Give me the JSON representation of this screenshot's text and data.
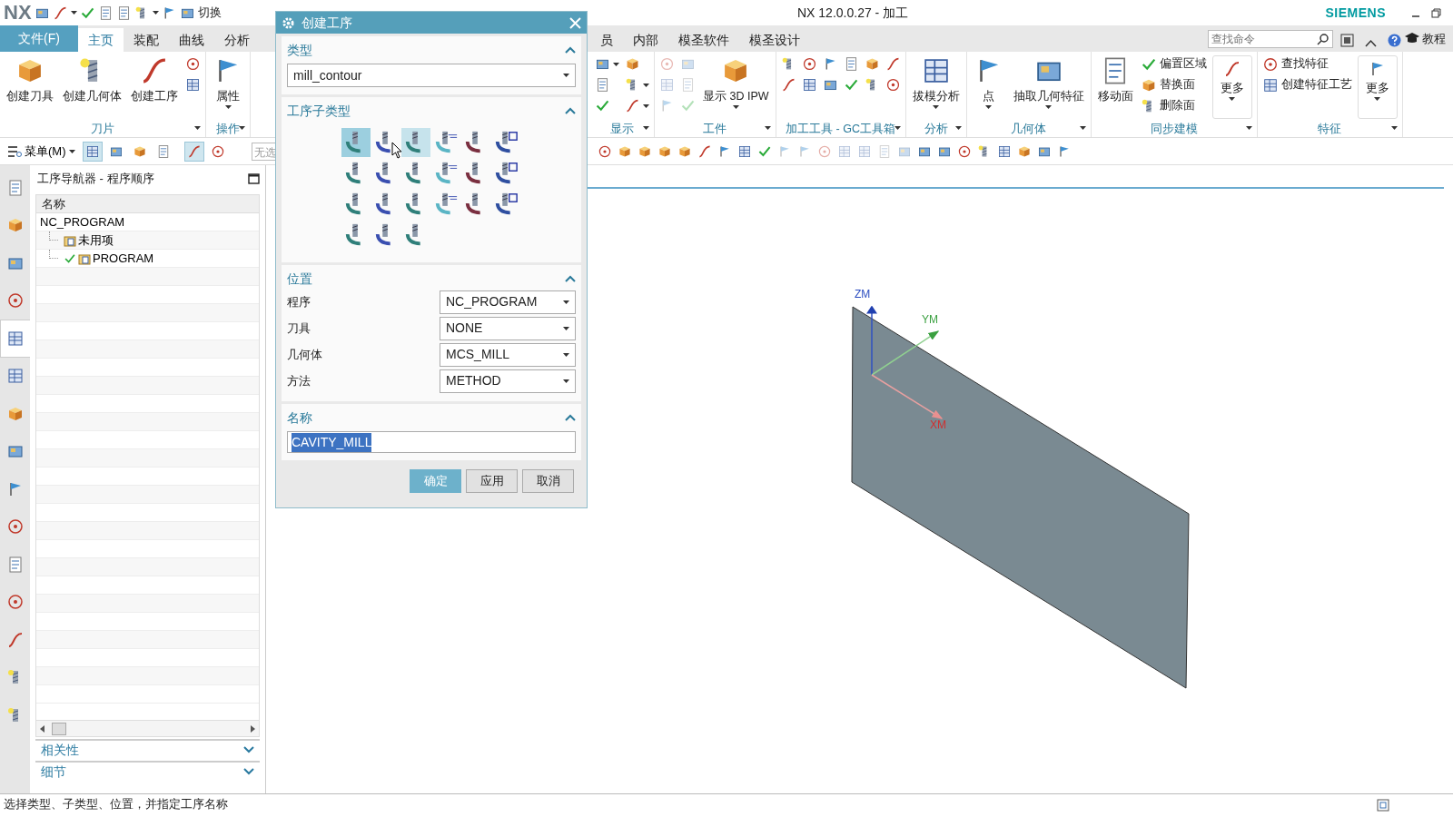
{
  "title_bar": {
    "logo": "NX",
    "switch_window_label": "切换",
    "title": "NX 12.0.0.27 - 加工",
    "brand": "SIEMENS"
  },
  "ribbon_tabs_left": [
    {
      "label": "文件(F)",
      "kind": "file",
      "selected": false
    },
    {
      "label": "主页",
      "kind": "tab",
      "selected": true
    },
    {
      "label": "装配",
      "kind": "tab",
      "selected": false
    },
    {
      "label": "曲线",
      "kind": "tab",
      "selected": false
    },
    {
      "label": "分析",
      "kind": "tab",
      "selected": false
    }
  ],
  "ribbon_tabs_right": [
    {
      "label": "员",
      "kind": "tab",
      "selected": false
    },
    {
      "label": "内部",
      "kind": "tab",
      "selected": false
    },
    {
      "label": "模圣软件",
      "kind": "tab",
      "selected": false
    },
    {
      "label": "模圣设计",
      "kind": "tab",
      "selected": false
    }
  ],
  "command_search": {
    "placeholder": "查找命令"
  },
  "help_label": "教程",
  "ribbon_groups_left": [
    {
      "label": "刀片",
      "items": [
        {
          "kind": "large",
          "label": "创建刀具"
        },
        {
          "kind": "large",
          "label": "创建几何体"
        },
        {
          "kind": "large",
          "label": "创建工序"
        },
        {
          "kind": "column",
          "items": [
            {
              "kind": "icon"
            },
            {
              "kind": "icon"
            }
          ]
        }
      ]
    },
    {
      "label": "操作",
      "items": [
        {
          "kind": "large",
          "label": "属性",
          "dropdown": true
        }
      ]
    }
  ],
  "ribbon_groups_right": [
    {
      "label": "显示",
      "items": [
        {
          "kind": "column",
          "items": [
            {
              "kind": "icon",
              "dropdown": true
            },
            {
              "kind": "icon"
            },
            {
              "kind": "icon"
            }
          ]
        },
        {
          "kind": "column",
          "items": [
            {
              "kind": "icon"
            },
            {
              "kind": "icon",
              "dropdown": true
            },
            {
              "kind": "icon",
              "dropdown": true
            }
          ]
        }
      ]
    },
    {
      "label": "工件",
      "items": [
        {
          "kind": "column",
          "items": [
            {
              "kind": "icon",
              "disabled": true
            },
            {
              "kind": "icon",
              "disabled": true
            },
            {
              "kind": "icon",
              "disabled": true
            }
          ]
        },
        {
          "kind": "column",
          "items": [
            {
              "kind": "icon",
              "disabled": true
            },
            {
              "kind": "icon",
              "disabled": true
            },
            {
              "kind": "icon",
              "disabled": true
            }
          ]
        },
        {
          "kind": "large",
          "label": "显示 3D IPW",
          "dropdown": true
        }
      ]
    },
    {
      "label": "加工工具 - GC工具箱",
      "items": [
        {
          "kind": "column",
          "items": [
            {
              "kind": "icon"
            },
            {
              "kind": "icon"
            }
          ]
        },
        {
          "kind": "column",
          "items": [
            {
              "kind": "icon"
            },
            {
              "kind": "icon"
            }
          ]
        },
        {
          "kind": "column",
          "items": [
            {
              "kind": "icon"
            },
            {
              "kind": "icon"
            }
          ]
        },
        {
          "kind": "column",
          "items": [
            {
              "kind": "icon"
            },
            {
              "kind": "icon"
            }
          ]
        },
        {
          "kind": "column",
          "items": [
            {
              "kind": "icon"
            },
            {
              "kind": "icon"
            }
          ]
        },
        {
          "kind": "column",
          "items": [
            {
              "kind": "icon"
            },
            {
              "kind": "icon"
            }
          ]
        }
      ]
    },
    {
      "label": "分析",
      "items": [
        {
          "kind": "large",
          "label": "拔模分析",
          "dropdown": true
        }
      ]
    },
    {
      "label": "几何体",
      "items": [
        {
          "kind": "large",
          "label": "点",
          "dropdown": true
        },
        {
          "kind": "large",
          "label": "抽取几何特征",
          "dropdown": true
        }
      ]
    },
    {
      "label": "同步建模",
      "items": [
        {
          "kind": "large",
          "label": "移动面"
        },
        {
          "kind": "column",
          "items": [
            {
              "kind": "small",
              "label": "偏置区域"
            },
            {
              "kind": "small",
              "label": "替换面"
            },
            {
              "kind": "small",
              "label": "删除面"
            }
          ]
        },
        {
          "kind": "more",
          "label": "更多",
          "dropdown": true
        }
      ]
    },
    {
      "label": "特征",
      "items": [
        {
          "kind": "column",
          "items": [
            {
              "kind": "small",
              "label": "查找特征"
            },
            {
              "kind": "small",
              "label": "创建特征工艺"
            }
          ]
        },
        {
          "kind": "more",
          "label": "更多",
          "dropdown": true
        }
      ]
    }
  ],
  "selection_bar": {
    "menu_label": "菜单(M)",
    "filter_placeholder": "无选",
    "toggles": [
      {
        "selected": true
      },
      {
        "selected": false
      },
      {
        "selected": false
      },
      {
        "selected": false
      },
      {
        "selected": true
      },
      {
        "selected": false
      }
    ]
  },
  "resource_bar": [
    {
      "selected": false
    },
    {
      "selected": false
    },
    {
      "selected": false
    },
    {
      "selected": false
    },
    {
      "selected": true
    },
    {
      "selected": false
    },
    {
      "selected": false
    },
    {
      "selected": false
    },
    {
      "selected": false
    },
    {
      "selected": false
    },
    {
      "selected": false
    },
    {
      "selected": false
    },
    {
      "selected": false
    },
    {
      "selected": false
    },
    {
      "selected": false
    }
  ],
  "navigator": {
    "title": "工序导航器 - 程序顺序",
    "column": "名称",
    "tree": [
      {
        "label": "NC_PROGRAM",
        "children": [
          {
            "label": "未用项",
            "checked": false
          },
          {
            "label": "PROGRAM",
            "checked": true
          }
        ]
      }
    ],
    "sections": [
      {
        "label": "相关性",
        "expanded": false
      },
      {
        "label": "细节",
        "expanded": false
      }
    ]
  },
  "dialog": {
    "title": "创建工序",
    "sections": [
      {
        "kind": "type",
        "title": "类型",
        "expanded": true,
        "value": "mill_contour"
      },
      {
        "kind": "subtypes",
        "title": "工序子类型",
        "expanded": true,
        "items": [
          {
            "selected": true,
            "hovered": false
          },
          {
            "selected": false,
            "hovered": false
          },
          {
            "selected": false,
            "hovered": true
          },
          {
            "selected": false,
            "hovered": false
          },
          {
            "selected": false,
            "hovered": false
          },
          {
            "selected": false,
            "hovered": false
          },
          {
            "selected": false,
            "hovered": false
          },
          {
            "selected": false,
            "hovered": false
          },
          {
            "selected": false,
            "hovered": false
          },
          {
            "selected": false,
            "hovered": false
          },
          {
            "selected": false,
            "hovered": false
          },
          {
            "selected": false,
            "hovered": false
          },
          {
            "selected": false,
            "hovered": false
          },
          {
            "selected": false,
            "hovered": false
          },
          {
            "selected": false,
            "hovered": false
          },
          {
            "selected": false,
            "hovered": false
          },
          {
            "selected": false,
            "hovered": false
          },
          {
            "selected": false,
            "hovered": false
          },
          {
            "selected": false,
            "hovered": false
          },
          {
            "selected": false,
            "hovered": false
          },
          {
            "selected": false,
            "hovered": false
          }
        ]
      },
      {
        "kind": "location",
        "title": "位置",
        "expanded": true,
        "fields": [
          {
            "label": "程序",
            "value": "NC_PROGRAM"
          },
          {
            "label": "刀具",
            "value": "NONE"
          },
          {
            "label": "几何体",
            "value": "MCS_MILL"
          },
          {
            "label": "方法",
            "value": "METHOD"
          }
        ]
      },
      {
        "kind": "name",
        "title": "名称",
        "expanded": true,
        "value": "CAVITY_MILL",
        "text_selected": true
      }
    ],
    "buttons": [
      {
        "label": "确定",
        "kind": "primary"
      },
      {
        "label": "应用",
        "kind": "normal"
      },
      {
        "label": "取消",
        "kind": "normal"
      }
    ]
  },
  "viewport": {
    "axes": {
      "z": "ZM",
      "y": "YM",
      "x": "XM"
    }
  },
  "status_bar": "选择类型、子类型、位置，并指定工序名称"
}
